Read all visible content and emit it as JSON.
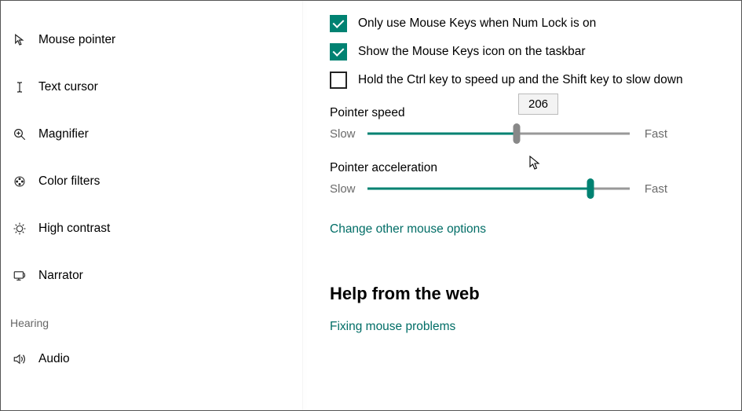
{
  "sidebar": {
    "items": [
      {
        "label": "Mouse pointer"
      },
      {
        "label": "Text cursor"
      },
      {
        "label": "Magnifier"
      },
      {
        "label": "Color filters"
      },
      {
        "label": "High contrast"
      },
      {
        "label": "Narrator"
      }
    ],
    "hearing_header": "Hearing",
    "audio_label": "Audio"
  },
  "checkboxes": {
    "numlock": {
      "label": "Only use Mouse Keys when Num Lock is on",
      "checked": true
    },
    "taskbar_icon": {
      "label": "Show the Mouse Keys icon on the taskbar",
      "checked": true
    },
    "ctrl_shift": {
      "label": "Hold the Ctrl key to speed up and the Shift key to slow down",
      "checked": false
    }
  },
  "slider_labels": {
    "slow": "Slow",
    "fast": "Fast"
  },
  "pointer_speed": {
    "label": "Pointer speed",
    "tooltip_value": "206",
    "fill_percent": 57
  },
  "pointer_accel": {
    "label": "Pointer acceleration",
    "fill_percent": 85
  },
  "links": {
    "other_options": "Change other mouse options",
    "fixing": "Fixing mouse problems"
  },
  "help_heading": "Help from the web"
}
